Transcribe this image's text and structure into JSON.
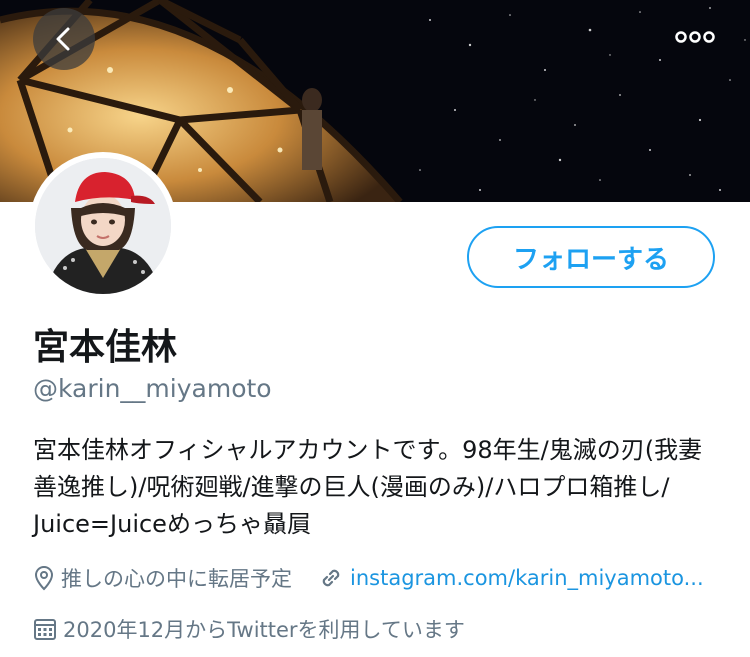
{
  "profile": {
    "name": "宮本佳林",
    "handle": "@karin__miyamoto",
    "bio_lines": [
      "宮本佳林オフィシャルアカウントです。98年生/鬼滅の刃(我妻",
      "善逸推し)/呪術廻戦/進撃の巨人(漫画のみ)/ハロプロ箱推し/",
      "Juice=Juiceめっちゃ贔屓"
    ],
    "location": "推しの心の中に転居予定",
    "website": "instagram.com/karin_miyamoto...",
    "joined": "2020年12月からTwitterを利用しています"
  },
  "actions": {
    "follow_label": "フォローする"
  },
  "icons": {
    "back": "chevron-left-icon",
    "more": "more-horizontal-icon",
    "location": "location-pin-icon",
    "link": "link-icon",
    "calendar": "calendar-icon"
  },
  "colors": {
    "accent": "#1da1f2",
    "link": "#1b95e0",
    "secondary_text": "#657786"
  }
}
